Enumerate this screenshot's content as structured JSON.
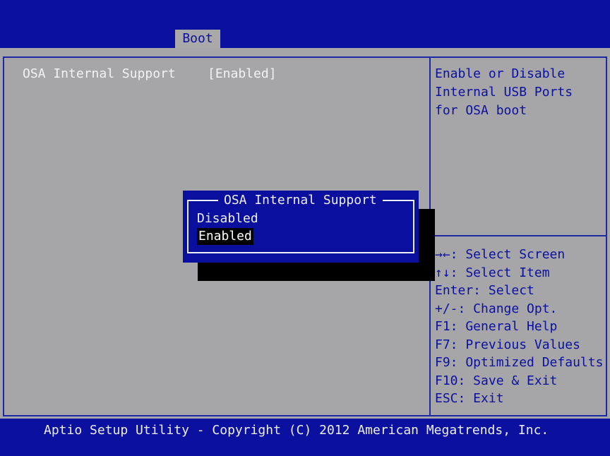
{
  "header": {
    "active_tab": "Boot"
  },
  "setting": {
    "label": "OSA Internal Support",
    "value": "[Enabled]"
  },
  "help": {
    "lines": [
      "Enable or Disable",
      "Internal USB Ports",
      "for OSA boot"
    ]
  },
  "keys": {
    "lines": [
      "→←: Select Screen",
      "↑↓: Select Item",
      "Enter: Select",
      "+/-: Change Opt.",
      "F1: General Help",
      "F7: Previous Values",
      "F9: Optimized Defaults",
      "F10: Save & Exit",
      "ESC: Exit"
    ]
  },
  "popup": {
    "title": "OSA Internal Support",
    "options": [
      "Disabled",
      "Enabled"
    ],
    "selected": "Enabled"
  },
  "footer": {
    "text": "Aptio Setup Utility - Copyright (C) 2012 American Megatrends, Inc."
  },
  "colors": {
    "background_blue": "#0a0f9e",
    "panel_gray": "#a6a6a9",
    "text_white": "#f3f3f5"
  }
}
